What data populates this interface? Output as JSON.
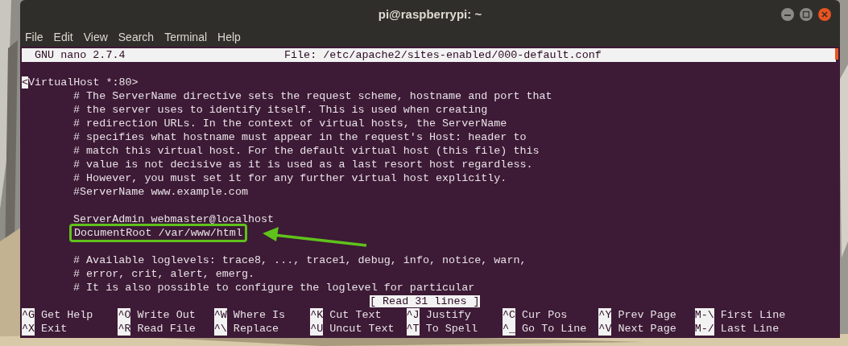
{
  "window": {
    "title": "pi@raspberrypi: ~"
  },
  "menu": [
    "File",
    "Edit",
    "View",
    "Search",
    "Terminal",
    "Help"
  ],
  "editor": {
    "header": {
      "app": "GNU nano 2.7.4",
      "file": "File: /etc/apache2/sites-enabled/000-default.conf"
    },
    "lines": [
      {
        "kind": "text",
        "text": "<VirtualHost *:80>",
        "cursor": true,
        "children": [
          {
            "kind": "text",
            "text": "# The ServerName directive sets the request scheme, hostname and port that"
          },
          {
            "kind": "text",
            "text": "# the server uses to identify itself. This is used when creating"
          },
          {
            "kind": "text",
            "text": "# redirection URLs. In the context of virtual hosts, the ServerName"
          },
          {
            "kind": "text",
            "text": "# specifies what hostname must appear in the request's Host: header to"
          },
          {
            "kind": "text",
            "text": "# match this virtual host. For the default virtual host (this file) this"
          },
          {
            "kind": "text",
            "text": "# value is not decisive as it is used as a last resort host regardless."
          },
          {
            "kind": "text",
            "text": "# However, you must set it for any further virtual host explicitly."
          },
          {
            "kind": "text",
            "text": "#ServerName www.example.com"
          },
          {
            "kind": "blank"
          },
          {
            "kind": "text",
            "text": "ServerAdmin webmaster@localhost"
          },
          {
            "kind": "text",
            "text": "DocumentRoot /var/www/html",
            "highlighted": true
          },
          {
            "kind": "blank"
          },
          {
            "kind": "text",
            "text": "# Available loglevels: trace8, ..., trace1, debug, info, notice, warn,"
          },
          {
            "kind": "text",
            "text": "# error, crit, alert, emerg."
          },
          {
            "kind": "text",
            "text": "# It is also possible to configure the loglevel for particular"
          }
        ]
      }
    ],
    "status": "[ Read 31 lines ]",
    "shortcuts": [
      [
        {
          "key": "^G",
          "label": "Get Help"
        },
        {
          "key": "^O",
          "label": "Write Out"
        },
        {
          "key": "^W",
          "label": "Where Is"
        },
        {
          "key": "^K",
          "label": "Cut Text"
        },
        {
          "key": "^J",
          "label": "Justify"
        },
        {
          "key": "^C",
          "label": "Cur Pos"
        },
        {
          "key": "^Y",
          "label": "Prev Page"
        },
        {
          "key": "M-\\",
          "label": "First Line"
        }
      ],
      [
        {
          "key": "^X",
          "label": "Exit"
        },
        {
          "key": "^R",
          "label": "Read File"
        },
        {
          "key": "^\\",
          "label": "Replace"
        },
        {
          "key": "^U",
          "label": "Uncut Text"
        },
        {
          "key": "^T",
          "label": "To Spell"
        },
        {
          "key": "^_",
          "label": "Go To Line"
        },
        {
          "key": "^V",
          "label": "Next Page"
        },
        {
          "key": "M-/",
          "label": "Last Line"
        }
      ]
    ]
  }
}
